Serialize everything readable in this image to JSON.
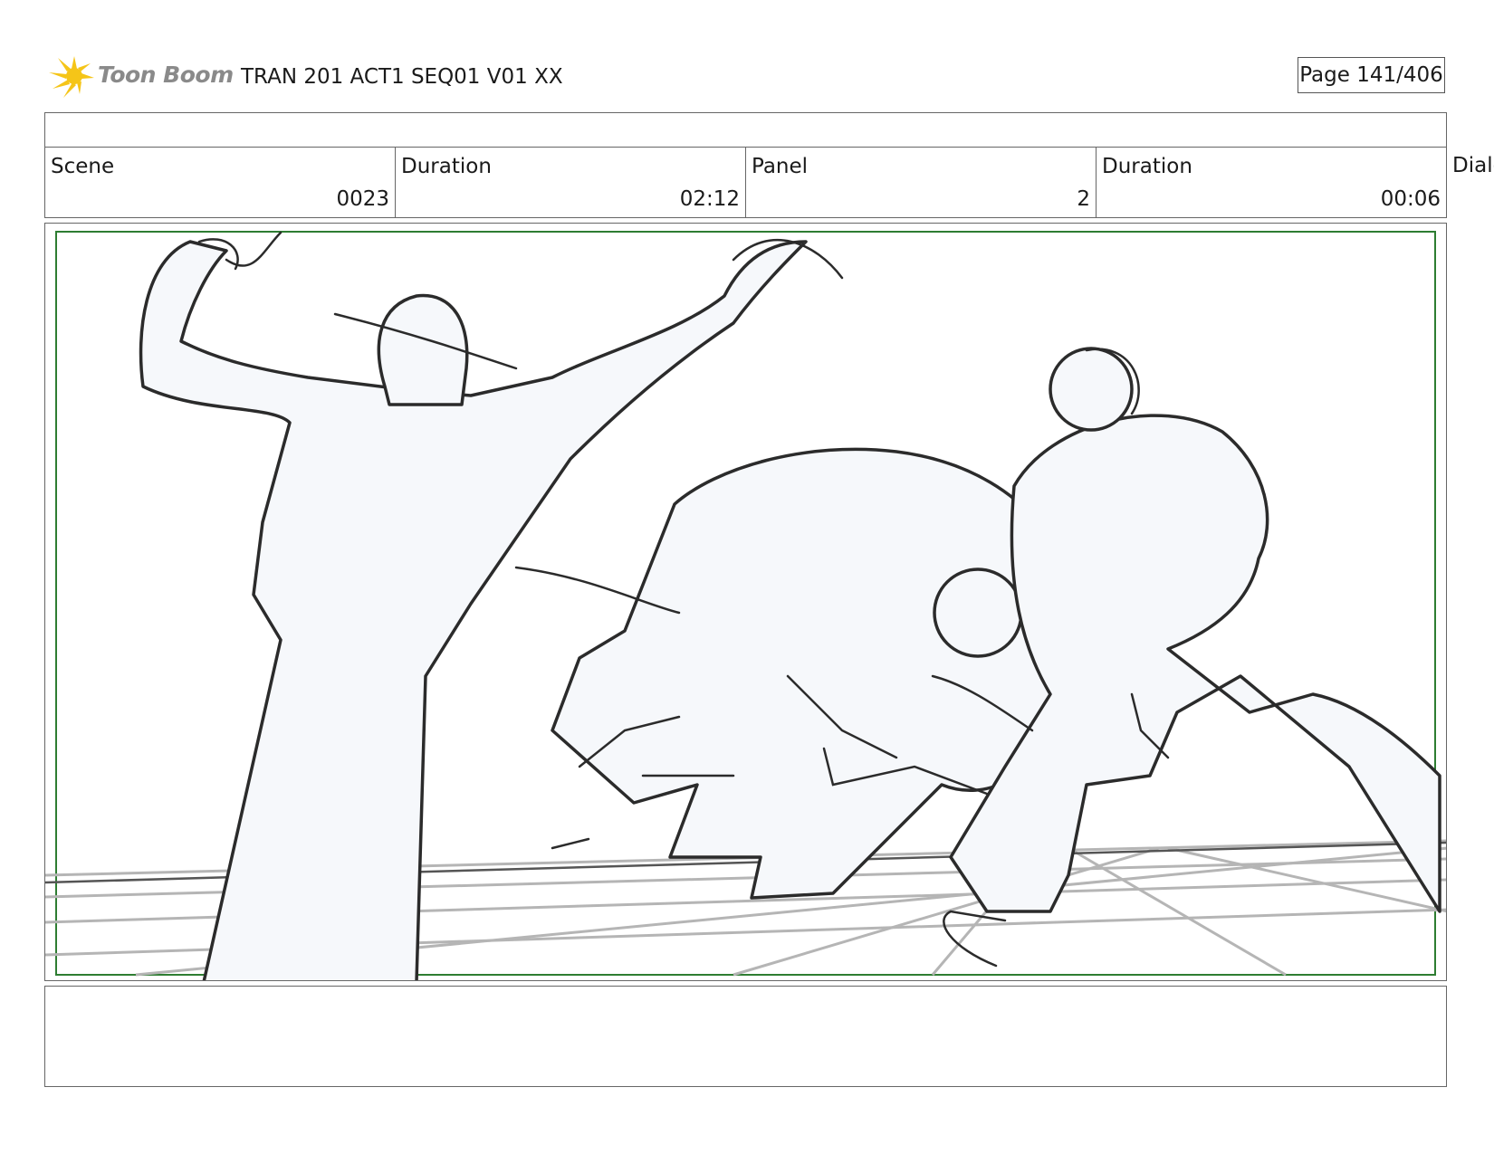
{
  "header": {
    "logo_text": "Toon Boom",
    "logo_icon": "starburst-logo-icon",
    "project_title": "TRAN 201 ACT1 SEQ01 V01 XX",
    "page_label": "Page 141/406"
  },
  "info": {
    "scene_label": "Scene",
    "scene_value": "0023",
    "scene_duration_label": "Duration",
    "scene_duration_value": "02:12",
    "panel_label": "Panel",
    "panel_value": "2",
    "panel_duration_label": "Duration",
    "panel_duration_value": "00:06",
    "dialog_label": "Dialo"
  },
  "colors": {
    "logo_yellow": "#f5c518",
    "safe_frame_green": "#2e7d32",
    "sketch_line": "#2b2b2b",
    "figure_fill": "#f6f8fb",
    "floor_grid": "#b5b5b5"
  }
}
